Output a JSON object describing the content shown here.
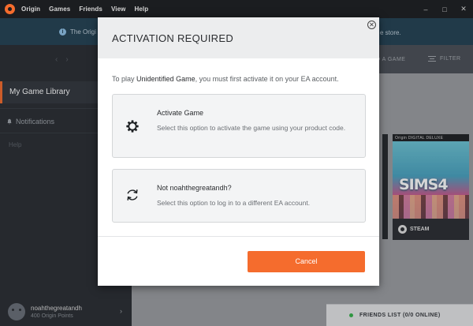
{
  "titlebar": {
    "menu": [
      "Origin",
      "Games",
      "Friends",
      "View",
      "Help"
    ],
    "controls": [
      "–",
      "□",
      "✕"
    ]
  },
  "notice": {
    "left_text": "The Origi",
    "right_text": "e store."
  },
  "sidebar": {
    "active_item": "My Game Library",
    "notifications": "Notifications",
    "help": "Help",
    "user": {
      "name": "noahthegreatandh",
      "points": "400 Origin Points"
    }
  },
  "main": {
    "add_game": "D A GAME",
    "filter": "FILTER",
    "sims_tile": {
      "edition": "Origin DIGITAL DELUXE",
      "logo": "SIMS4",
      "platform": "STEAM"
    },
    "friends_list": "FRIENDS LIST (0/0 ONLINE)"
  },
  "modal": {
    "title": "ACTIVATION REQUIRED",
    "desc_prefix": "To play ",
    "desc_game": "Unidentified Game",
    "desc_suffix": ", you must first activate it on your EA account.",
    "options": [
      {
        "title": "Activate Game",
        "text": "Select this option to activate the game using your product code.",
        "icon": "gear-icon"
      },
      {
        "title": "Not noahthegreatandh?",
        "text": "Select this option to log in to a different EA account.",
        "icon": "refresh-icon"
      }
    ],
    "cancel": "Cancel",
    "close_glyph": "✕"
  },
  "colors": {
    "accent": "#f56c2d",
    "online": "#35b24a"
  }
}
